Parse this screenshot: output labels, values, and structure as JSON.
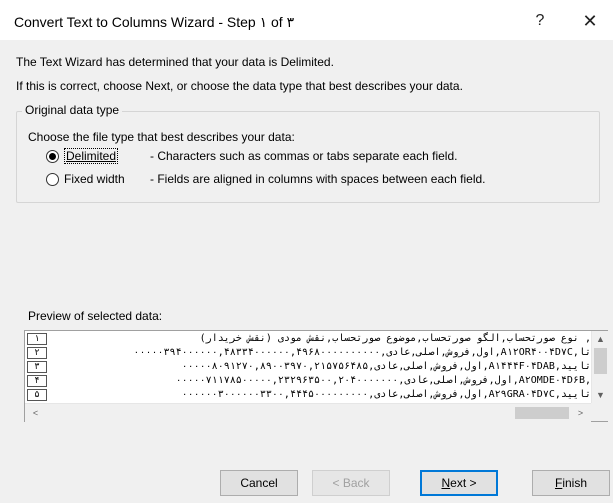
{
  "window": {
    "title": "Convert Text to Columns Wizard - Step ۱ of ۳",
    "help_glyph": "?",
    "close_glyph": "✕"
  },
  "intro": {
    "line1": "The Text Wizard has determined that your data is Delimited.",
    "line2": "If this is correct, choose Next, or choose the data type that best describes your data."
  },
  "original_data_type": {
    "legend": "Original data type",
    "description": "Choose the file type that best describes your data:",
    "options": [
      {
        "label": "Delimited",
        "desc": "- Characters such as commas or tabs separate each field.",
        "selected": true
      },
      {
        "label": "Fixed width",
        "desc": "- Fields are aligned in columns with spaces between each field.",
        "selected": false
      }
    ]
  },
  "preview": {
    "label": "Preview of selected data:",
    "rows": [
      {
        "num": "۱",
        "text": "نوع صورتحساب,الگو صورتحساب,موضوع صورتحساب,نقش مودی (نقش خریدار) ,"
      },
      {
        "num": "۲",
        "text": "اول,فروش,اصلی,عادی,۰۰۰۰۰۳۹۴۰۰۰۰۰۰,۴۸۳۳۴۰۰۰۰۰۰,۴۹۶۸۰۰۰۰۰۰۰۰۰۰,A۱۲OR۴۰۰۴D۷C,تا"
      },
      {
        "num": "۳",
        "text": "اول,فروش,اصلی,عادی,۰۰۰۰۰۸۰۹۱۲۷۰,۸۹۰۰۳۹۷۰,۲۱۵۷۵۶۴۸۵,A۱۴۴۴F۰۴DAB,تایید"
      },
      {
        "num": "۴",
        "text": "اول,فروش,اصلی,عادی,۰۰۰۰۰۷۱۱۷۸۵۰۰۰۰۰,۲۳۲۹۶۳۵۰۰,۲۰۴۰۰۰۰۰۰۰,A۲OMDE۰۴D۶B,"
      },
      {
        "num": "۵",
        "text": "اول,فروش,اصلی,عادی,۰۰۰۰۰۰۳۰۰۰۰۰۰۳۳۰۰,۴۴۴۵۰۰۰۰۰۰۰۰۰,A۲۹GRA۰۴D۷C,تایید"
      }
    ]
  },
  "buttons": {
    "cancel": "Cancel",
    "back": "< Back",
    "next_pre": "",
    "next_u": "N",
    "next_post": "ext >",
    "finish_u": "F",
    "finish_post": "inish"
  },
  "scroll_glyphs": {
    "up": "▲",
    "down": "▼",
    "left": "<",
    "right": ">"
  }
}
